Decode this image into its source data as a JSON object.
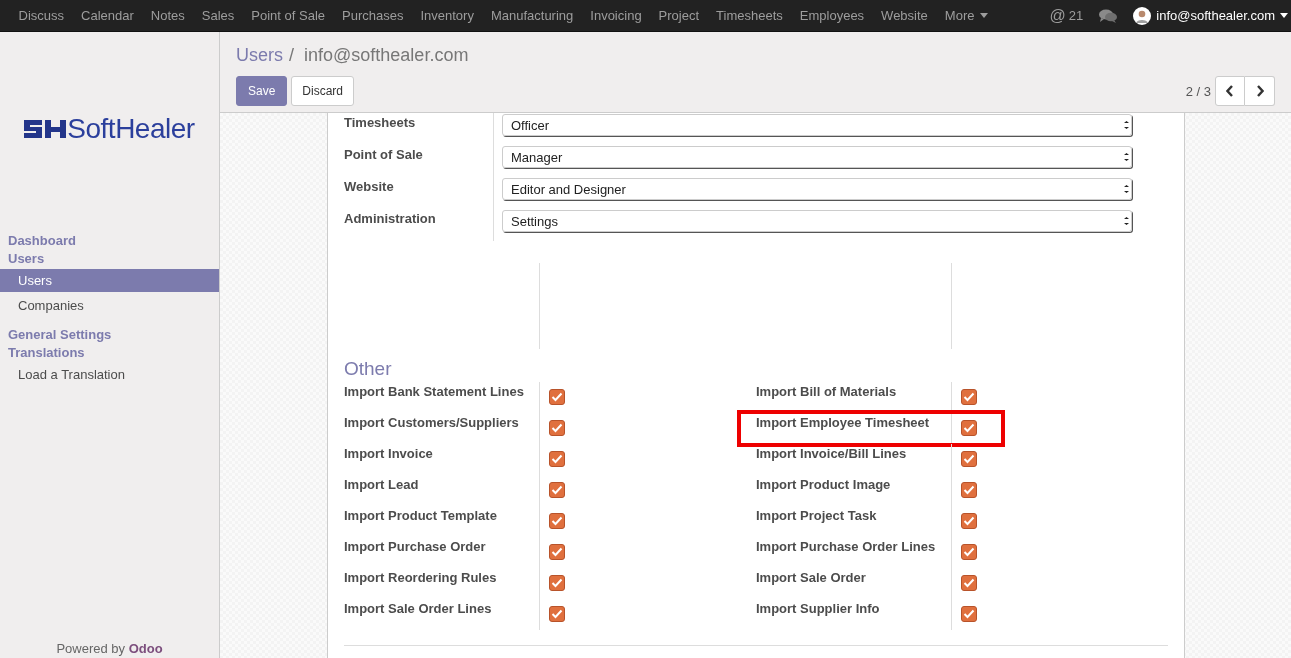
{
  "top_menu": [
    {
      "label": "Discuss"
    },
    {
      "label": "Calendar"
    },
    {
      "label": "Notes"
    },
    {
      "label": "Sales"
    },
    {
      "label": "Point of Sale"
    },
    {
      "label": "Purchases"
    },
    {
      "label": "Inventory"
    },
    {
      "label": "Manufacturing"
    },
    {
      "label": "Invoicing"
    },
    {
      "label": "Project"
    },
    {
      "label": "Timesheets"
    },
    {
      "label": "Employees"
    },
    {
      "label": "Website"
    }
  ],
  "more_menu": {
    "label": "More"
  },
  "mentions": {
    "symbol": "@",
    "count": "21"
  },
  "user": {
    "email": "info@softhealer.com"
  },
  "logo": {
    "text": "SoftHealer"
  },
  "breadcrumb": {
    "parent": "Users",
    "separator": "/",
    "current": "info@softhealer.com"
  },
  "buttons": [
    {
      "kind": "primary",
      "label": "Save"
    },
    {
      "kind": "secondary",
      "label": "Discard"
    }
  ],
  "pager": {
    "text": "2 / 3"
  },
  "sidebar": [
    {
      "label": "Dashboard"
    },
    {
      "label": "Users",
      "children": [
        {
          "label": "Users",
          "selected": true
        },
        {
          "label": "Companies",
          "selected": false
        }
      ]
    },
    {
      "label": "General Settings"
    },
    {
      "label": "Translations",
      "children": [
        {
          "label": "Load a Translation",
          "selected": false
        }
      ]
    }
  ],
  "access_rights": [
    {
      "label": "Timesheets",
      "value": "Officer"
    },
    {
      "label": "Point of Sale",
      "value": "Manager"
    },
    {
      "label": "Website",
      "value": "Editor and Designer"
    },
    {
      "label": "Administration",
      "value": "Settings"
    }
  ],
  "other": {
    "title": "Other",
    "left": [
      {
        "label": "Import Bank Statement Lines",
        "checked": true,
        "highlighted": false
      },
      {
        "label": "Import Customers/Suppliers",
        "checked": true,
        "highlighted": false
      },
      {
        "label": "Import Invoice",
        "checked": true,
        "highlighted": false
      },
      {
        "label": "Import Lead",
        "checked": true,
        "highlighted": false
      },
      {
        "label": "Import Product Template",
        "checked": true,
        "highlighted": false
      },
      {
        "label": "Import Purchase Order",
        "checked": true,
        "highlighted": false
      },
      {
        "label": "Import Reordering Rules",
        "checked": true,
        "highlighted": false
      },
      {
        "label": "Import Sale Order Lines",
        "checked": true,
        "highlighted": false
      }
    ],
    "right": [
      {
        "label": "Import Bill of Materials",
        "checked": true,
        "highlighted": false
      },
      {
        "label": "Import Employee Timesheet",
        "checked": true,
        "highlighted": true
      },
      {
        "label": "Import Invoice/Bill Lines",
        "checked": true,
        "highlighted": false
      },
      {
        "label": "Import Product Image",
        "checked": true,
        "highlighted": false
      },
      {
        "label": "Import Project Task",
        "checked": true,
        "highlighted": false
      },
      {
        "label": "Import Purchase Order Lines",
        "checked": true,
        "highlighted": false
      },
      {
        "label": "Import Sale Order",
        "checked": true,
        "highlighted": false
      },
      {
        "label": "Import Supplier Info",
        "checked": true,
        "highlighted": false
      }
    ]
  },
  "footer": {
    "text": "Powered by",
    "link": "Odoo"
  }
}
